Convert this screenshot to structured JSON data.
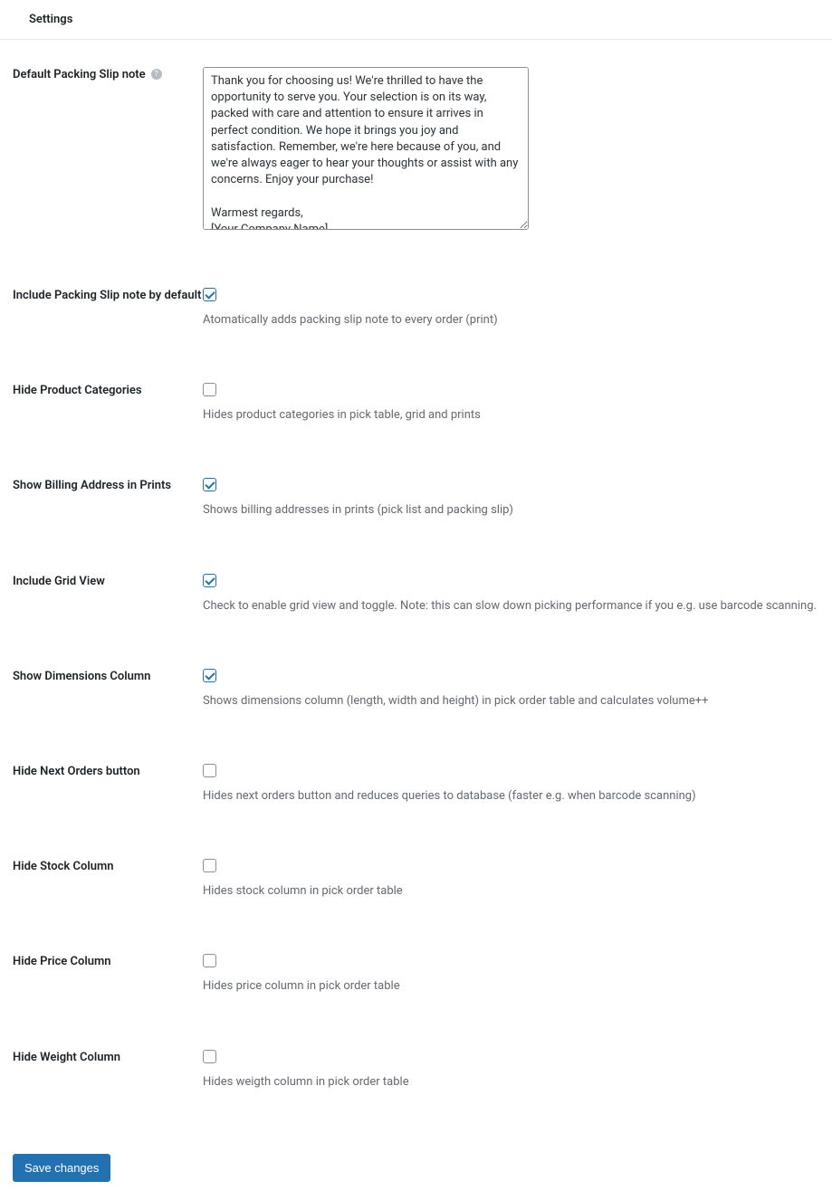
{
  "header": {
    "title": "Settings"
  },
  "fields": {
    "packing_slip_note": {
      "label": "Default Packing Slip note",
      "value": "Thank you for choosing us! We're thrilled to have the opportunity to serve you. Your selection is on its way, packed with care and attention to ensure it arrives in perfect condition. We hope it brings you joy and satisfaction. Remember, we're here because of you, and we're always eager to hear your thoughts or assist with any concerns. Enjoy your purchase!\n\nWarmest regards,\n[Your Company Name]"
    },
    "include_note_default": {
      "label": "Include Packing Slip note by default",
      "checked": true,
      "desc": "Atomatically adds packing slip note to every order (print)"
    },
    "hide_categories": {
      "label": "Hide Product Categories",
      "checked": false,
      "desc": "Hides product categories in pick table, grid and prints"
    },
    "show_billing": {
      "label": "Show Billing Address in Prints",
      "checked": true,
      "desc": "Shows billing addresses in prints (pick list and packing slip)"
    },
    "include_grid": {
      "label": "Include Grid View",
      "checked": true,
      "desc": "Check to enable grid view and toggle. Note: this can slow down picking performance if you e.g. use barcode scanning."
    },
    "show_dimensions": {
      "label": "Show Dimensions Column",
      "checked": true,
      "desc": "Shows dimensions column (length, width and height) in pick order table and calculates volume++"
    },
    "hide_next_orders": {
      "label": "Hide Next Orders button",
      "checked": false,
      "desc": "Hides next orders button and reduces queries to database (faster e.g. when barcode scanning)"
    },
    "hide_stock": {
      "label": "Hide Stock Column",
      "checked": false,
      "desc": "Hides stock column in pick order table"
    },
    "hide_price": {
      "label": "Hide Price Column",
      "checked": false,
      "desc": "Hides price column in pick order table"
    },
    "hide_weight": {
      "label": "Hide Weight Column",
      "checked": false,
      "desc": "Hides weigth column in pick order table"
    }
  },
  "actions": {
    "save": "Save changes"
  }
}
